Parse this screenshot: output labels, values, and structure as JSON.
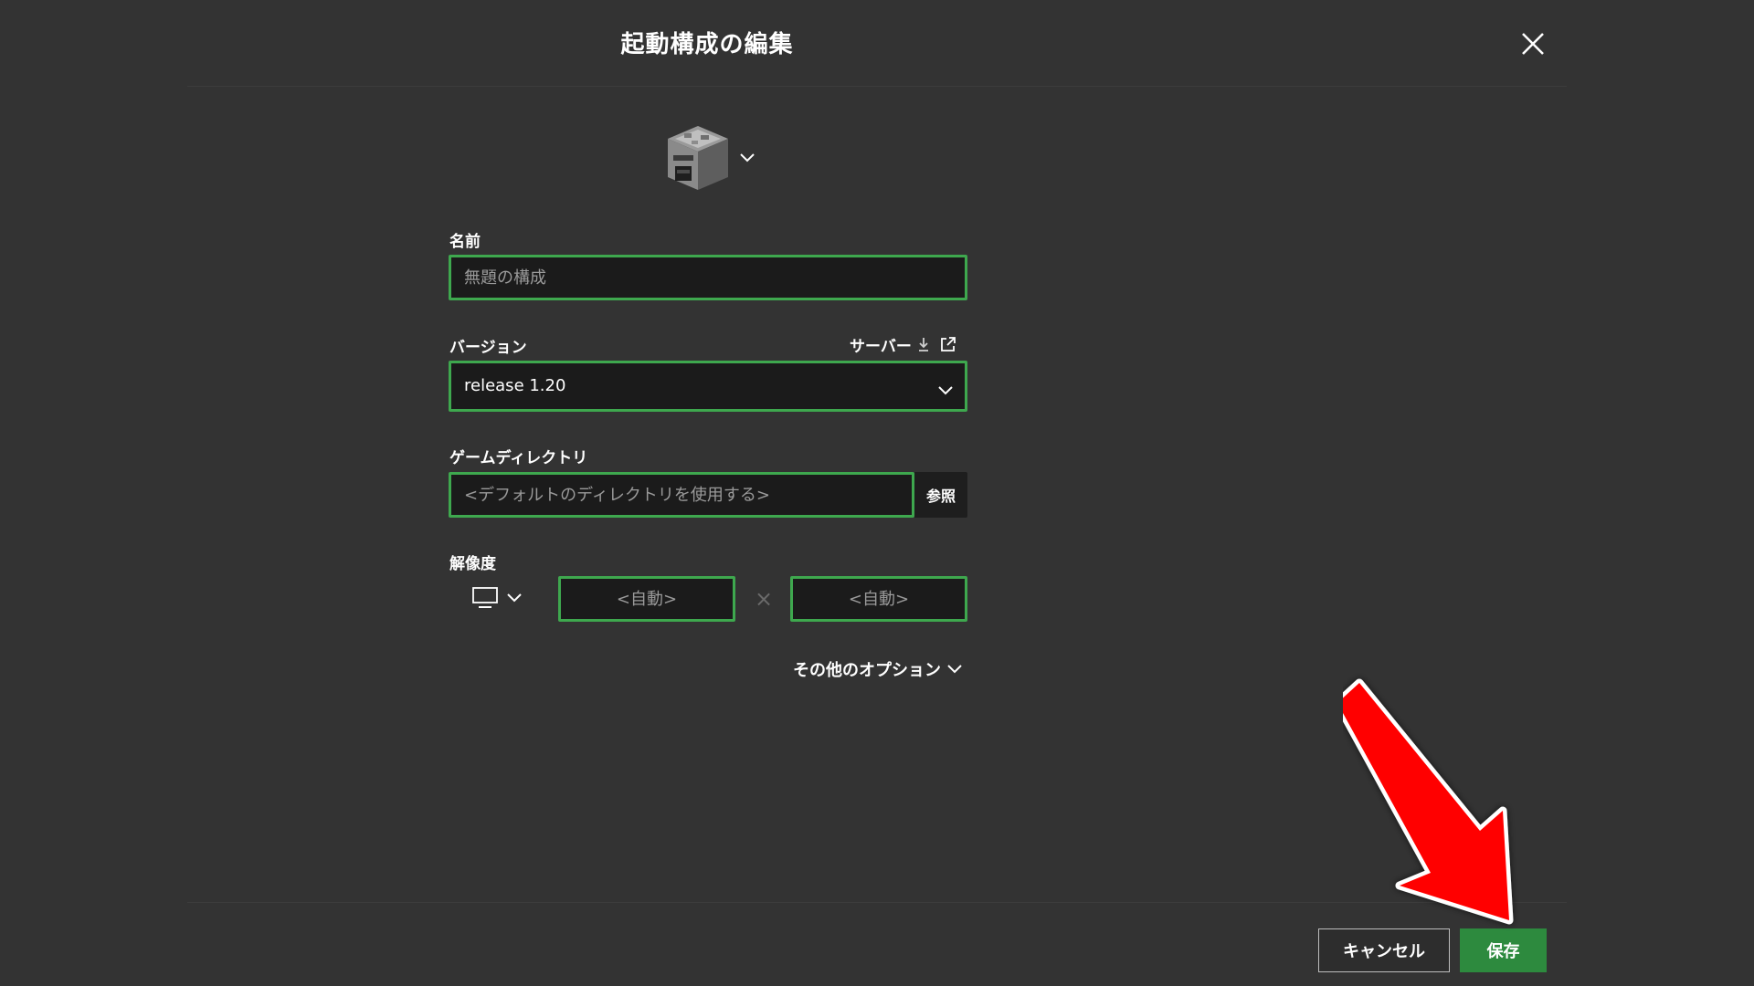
{
  "dialog": {
    "title": "起動構成の編集",
    "close_icon": "close-icon"
  },
  "icon_picker": {
    "icon": "furnace-icon",
    "chevron": "chevron-down-icon"
  },
  "name": {
    "label": "名前",
    "value": "",
    "placeholder": "無題の構成"
  },
  "version": {
    "label": "バージョン",
    "selected": "release 1.20",
    "server_link_label": "サーバー",
    "server_icons": [
      "download-icon",
      "external-link-icon"
    ]
  },
  "game_directory": {
    "label": "ゲームディレクトリ",
    "value": "",
    "placeholder": "<デフォルトのディレクトリを使用する>",
    "browse_label": "参照"
  },
  "resolution": {
    "label": "解像度",
    "monitor_icon": "monitor-icon",
    "width_placeholder": "<自動>",
    "height_placeholder": "<自動>",
    "separator": "×"
  },
  "more_options": {
    "label": "その他のオプション"
  },
  "footer": {
    "cancel_label": "キャンセル",
    "save_label": "保存"
  },
  "colors": {
    "background": "#333333",
    "field_border": "#3ea84e",
    "save_button": "#2d8a3e",
    "annotation_arrow": "#ff0000"
  }
}
